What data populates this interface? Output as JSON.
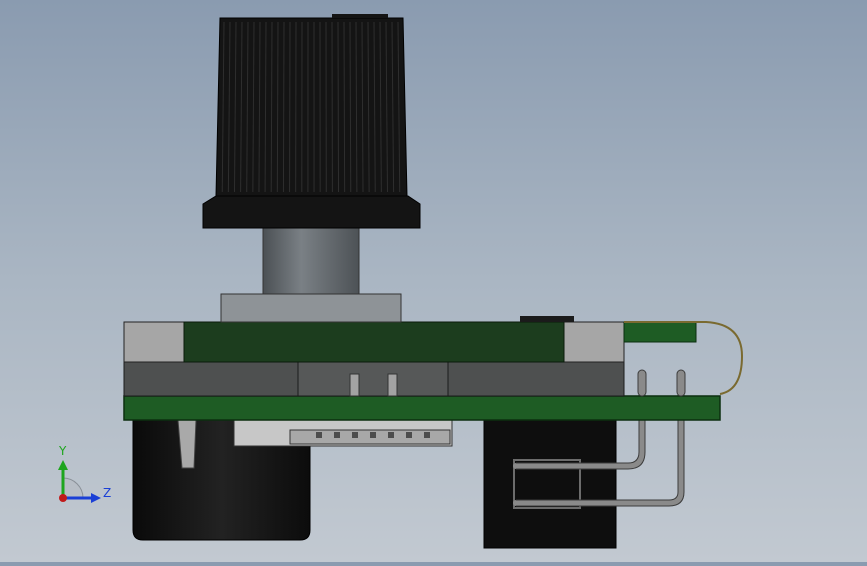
{
  "triad": {
    "y_label": "Y",
    "z_label": "Z"
  },
  "colors": {
    "background_top": "#8a9bb0",
    "background_bottom": "#c2c9d1",
    "knob": "#141414",
    "shaft": "#5c6266",
    "pcb_green": "#1e5c24",
    "pcb_dark_green": "#1c3d1e",
    "housing_gray": "#4e5050",
    "light_gray": "#a6a6a6",
    "y_axis": "#1ea51e",
    "z_axis": "#1a3fd6",
    "origin": "#c01a1a"
  },
  "parts": [
    "knurled-knob",
    "knob-base-flange",
    "shaft",
    "shaft-bushing",
    "top-pcb",
    "switch-housing",
    "main-pcb",
    "bottom-connector",
    "cylindrical-body",
    "bent-leads",
    "wire-loop"
  ]
}
